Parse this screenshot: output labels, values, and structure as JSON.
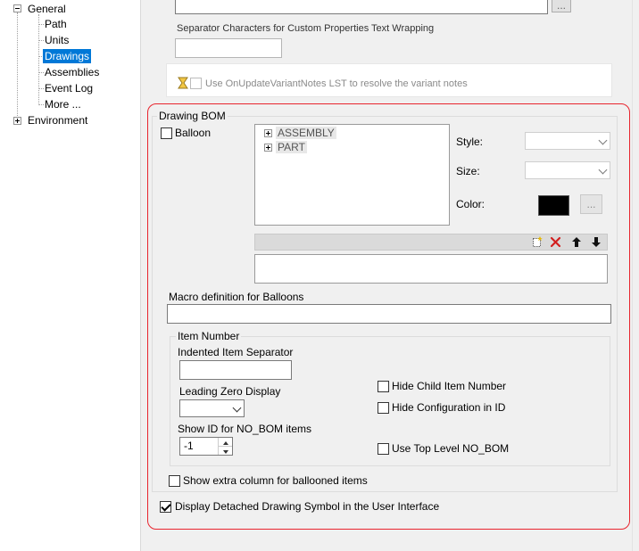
{
  "tree": {
    "items": [
      {
        "label": "General",
        "expander": "minus"
      },
      {
        "label": "Path"
      },
      {
        "label": "Units"
      },
      {
        "label": "Drawings",
        "selected": true
      },
      {
        "label": "Assemblies"
      },
      {
        "label": "Event Log"
      },
      {
        "label": "More ..."
      },
      {
        "label": "Environment",
        "expander": "plus"
      }
    ]
  },
  "top": {
    "browse_label": "...",
    "separator_label": "Separator Characters for Custom Properties Text Wrapping",
    "variant_label": "Use OnUpdateVariantNotes LST to resolve the variant notes"
  },
  "drawing_bom": {
    "title": "Drawing BOM",
    "balloon_label": "Balloon",
    "tree_items": [
      "ASSEMBLY",
      "PART"
    ],
    "style_label": "Style:",
    "size_label": "Size:",
    "color_label": "Color:",
    "color_value": "#000000",
    "color_browse_label": "...",
    "macro_label": "Macro definition for Balloons",
    "item_number": {
      "title": "Item Number",
      "indented_label": "Indented Item Separator",
      "leading_zero_label": "Leading Zero Display",
      "show_id_label": "Show ID for NO_BOM items",
      "show_id_value": "-1",
      "hide_child_label": "Hide Child Item Number",
      "hide_config_label": "Hide Configuration in ID",
      "top_level_label": "Use Top Level NO_BOM"
    },
    "extra_column_label": "Show extra column for ballooned items",
    "detached_label": "Display Detached Drawing Symbol in the User Interface",
    "detached_checked": true
  }
}
